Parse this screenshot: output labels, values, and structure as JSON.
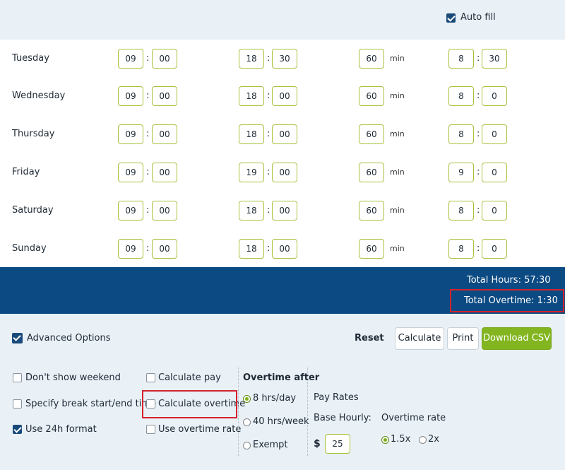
{
  "autofill": {
    "label": "Auto fill",
    "checked": true
  },
  "rows": [
    {
      "day": "Tuesday",
      "start_h": "09",
      "start_m": "00",
      "end_h": "18",
      "end_m": "30",
      "break": "60",
      "total_h": "8",
      "total_m": "30"
    },
    {
      "day": "Wednesday",
      "start_h": "09",
      "start_m": "00",
      "end_h": "18",
      "end_m": "00",
      "break": "60",
      "total_h": "8",
      "total_m": "0"
    },
    {
      "day": "Thursday",
      "start_h": "09",
      "start_m": "00",
      "end_h": "18",
      "end_m": "00",
      "break": "60",
      "total_h": "8",
      "total_m": "0"
    },
    {
      "day": "Friday",
      "start_h": "09",
      "start_m": "00",
      "end_h": "19",
      "end_m": "00",
      "break": "60",
      "total_h": "9",
      "total_m": "0"
    },
    {
      "day": "Saturday",
      "start_h": "09",
      "start_m": "00",
      "end_h": "18",
      "end_m": "00",
      "break": "60",
      "total_h": "8",
      "total_m": "0"
    },
    {
      "day": "Sunday",
      "start_h": "09",
      "start_m": "00",
      "end_h": "18",
      "end_m": "00",
      "break": "60",
      "total_h": "8",
      "total_m": "0"
    }
  ],
  "break_unit": "min",
  "time_separator": ":",
  "totals": {
    "hours": "Total Hours:  57:30",
    "overtime": "Total Overtime: 1:30"
  },
  "advanced": {
    "label": "Advanced Options",
    "checked": true
  },
  "buttons": {
    "reset": "Reset",
    "calculate": "Calculate",
    "print": "Print",
    "download": "Download CSV"
  },
  "options": {
    "dont_show_weekend": {
      "label": "Don't show weekend",
      "checked": false
    },
    "specify_break": {
      "label": "Specify break start/end time",
      "checked": false
    },
    "use_24h": {
      "label": "Use 24h format",
      "checked": true
    },
    "calculate_pay": {
      "label": "Calculate pay",
      "checked": false
    },
    "calculate_overtime": {
      "label": "Calculate overtime",
      "checked": false
    },
    "use_overtime_rate": {
      "label": "Use overtime rate",
      "checked": false
    }
  },
  "overtime_after": {
    "title": "Overtime after",
    "options": [
      "8 hrs/day",
      "40 hrs/week",
      "Exempt"
    ],
    "selected": "8 hrs/day"
  },
  "pay_rates": {
    "title": "Pay Rates",
    "base_label": "Base Hourly:",
    "currency": "$",
    "base_value": "25",
    "overtime_rate_label": "Overtime rate",
    "rates": [
      "1.5x",
      "2x"
    ],
    "selected_rate": "1.5x"
  },
  "colors": {
    "header_blue": "#0b4a82",
    "accent_green": "#82b51f",
    "highlight_red": "#d3232f",
    "panel_bg": "#e9f0f6"
  }
}
